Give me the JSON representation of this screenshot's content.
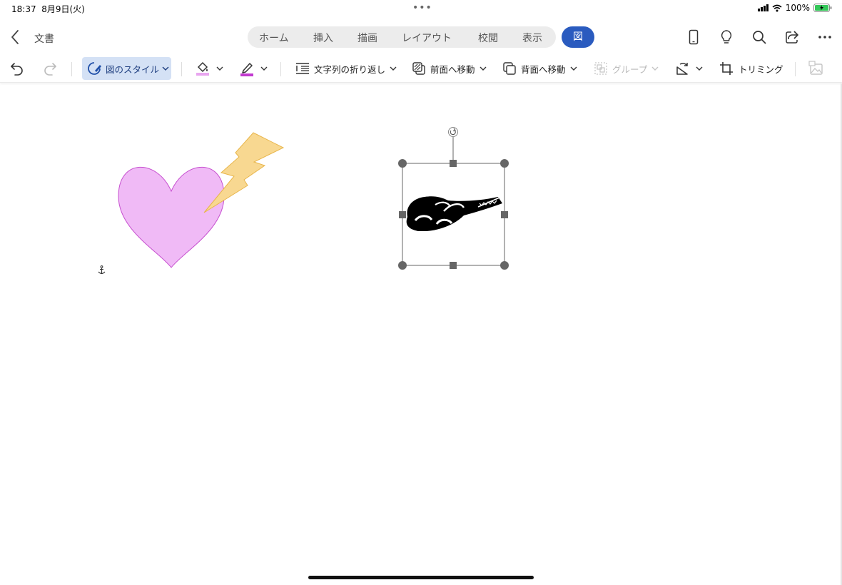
{
  "status": {
    "time": "18:37",
    "date": "8月9日(火)",
    "battery": "100%"
  },
  "doc": {
    "title": "文書"
  },
  "tabs": [
    "ホーム",
    "挿入",
    "描画",
    "レイアウト",
    "校閲",
    "表示"
  ],
  "active_tab": "図",
  "ribbon": {
    "style_label": "図のスタイル",
    "wrap_label": "文字列の折り返し",
    "front_label": "前面へ移動",
    "back_label": "背面へ移動",
    "group_label": "グループ",
    "crop_label": "トリミング"
  },
  "colors": {
    "accent": "#2a5bbf",
    "heart_fill": "#f0baf6",
    "heart_stroke": "#c64fcf",
    "bolt_fill": "#f8d891",
    "bolt_stroke": "#e8b54a"
  },
  "icons": {
    "back": "chevron-left-icon",
    "phone": "phone-icon",
    "lightbulb": "lightbulb-icon",
    "search": "search-icon",
    "share": "share-icon",
    "more": "more-icon",
    "undo": "undo-icon",
    "redo": "redo-icon",
    "fill": "fill-bucket-icon",
    "pen": "pen-icon",
    "anchor": "anchor-icon",
    "rotate": "rotate-handle-icon"
  }
}
